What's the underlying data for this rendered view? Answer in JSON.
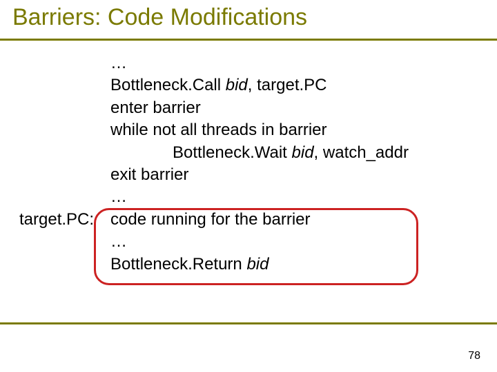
{
  "title": "Barriers: Code Modifications",
  "label": "target.PC:",
  "lines": {
    "l0": "…",
    "l1a": "Bottleneck.Call ",
    "l1b": "bid",
    "l1c": ", target.PC",
    "l2": "enter barrier",
    "l3": "while not all threads in barrier",
    "l4a": "Bottleneck.Wait ",
    "l4b": "bid",
    "l4c": ", watch_addr",
    "l5": "exit barrier",
    "l6": "…",
    "l7": "code running for the barrier",
    "l8": "…",
    "l9a": "Bottleneck.Return ",
    "l9b": "bid"
  },
  "page": "78"
}
